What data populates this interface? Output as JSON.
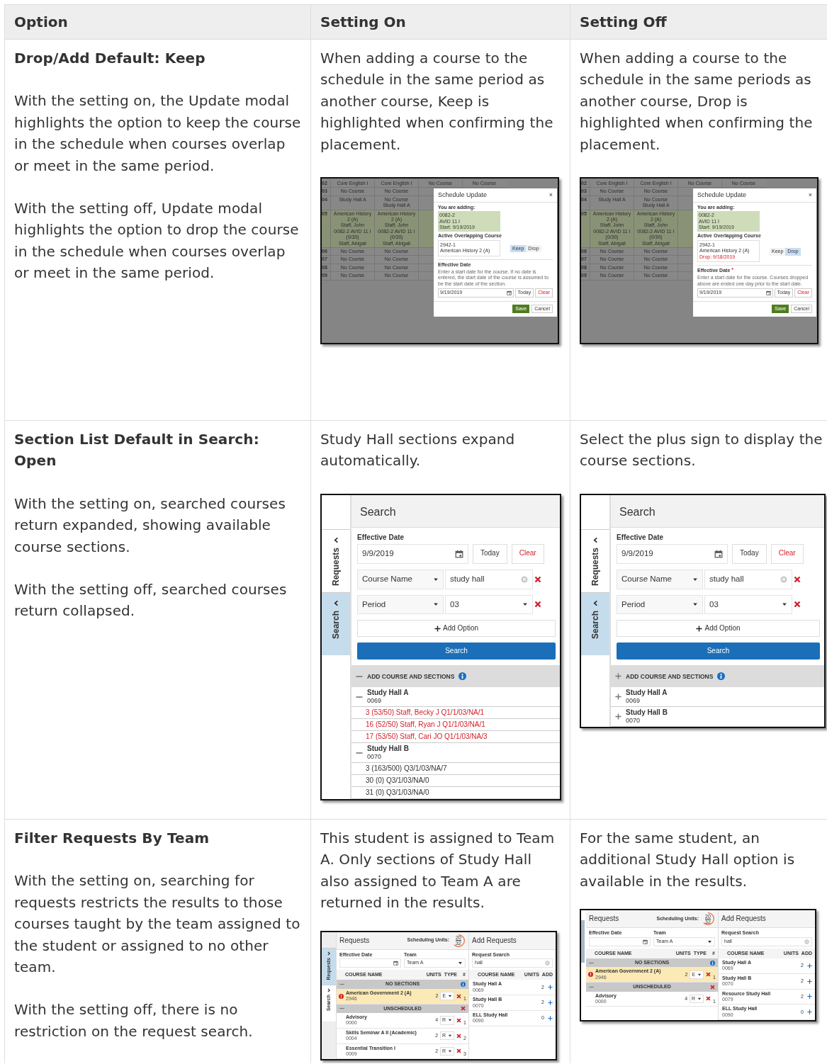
{
  "columns": [
    "Option",
    "Setting On",
    "Setting Off"
  ],
  "rows": [
    {
      "option": {
        "title": "Drop/Add Default: Keep",
        "paragraphs": [
          "With the setting on, the Update modal highlights the option to keep the course in the schedule when courses overlap or meet in the same period.",
          "With the setting off, Update modal highlights the option to drop the course in the schedule when courses overlap or meet in the same period."
        ]
      },
      "on": {
        "text": "When adding a course to the schedule in the same period as another course, Keep is highlighted when confirming the placement.",
        "screenshot": {
          "kind": "schedule_update",
          "grid": [
            {
              "period": "02",
              "highlighted": false,
              "cells": [
                "Core English I",
                "Core English I",
                "No Course",
                "No Course"
              ]
            },
            {
              "period": "03",
              "highlighted": false,
              "cells": [
                "No Course",
                "No Course"
              ]
            },
            {
              "period": "04",
              "highlighted": false,
              "cells": [
                "Study Hall A",
                "No Course\nStudy Hall A"
              ]
            },
            {
              "period": "05",
              "highlighted": true,
              "cells": [
                "American History 2 (A)\nStaff, John\n0082-2 AVID 11 I (0/30)\nStaff, Abigail",
                "American History 2 (A)\nStaff, John\n0082-2 AVID 11 I (0/30)\nStaff, Abigail"
              ]
            },
            {
              "period": "06",
              "highlighted": false,
              "cells": [
                "No Course",
                "No Course"
              ]
            },
            {
              "period": "07",
              "highlighted": false,
              "cells": [
                "No Course",
                "No Course"
              ]
            },
            {
              "period": "08",
              "highlighted": false,
              "cells": [
                "No Course",
                "No Course"
              ]
            },
            {
              "period": "09",
              "highlighted": false,
              "cells": [
                "No Course",
                "No Course"
              ]
            }
          ],
          "modal": {
            "title": "Schedule Update",
            "close": "×",
            "adding_label": "You are adding:",
            "adding": "0082-2\nAVID 11 I\nStart: 9/19/2019",
            "overlap_label": "Active Overlapping Course",
            "overlap": "2942-1\nAmerican History 2 (A)",
            "toggle": [
              {
                "label": "Keep",
                "selected": true
              },
              {
                "label": "Drop",
                "selected": false
              }
            ],
            "date_label": "Effective Date",
            "help": "Enter a start date for the course. If no date is entered, the start date of the course is assumed to be the start date of the section.",
            "date": "9/19/2019",
            "today": "Today",
            "clear": "Clear",
            "save": "Save",
            "cancel": "Cancel"
          }
        }
      },
      "off": {
        "text": "When adding a course to the schedule in the same periods as another course, Drop is highlighted when confirming the placement.",
        "screenshot": {
          "kind": "schedule_update",
          "grid": [
            {
              "period": "02",
              "highlighted": false,
              "cells": [
                "Core English I",
                "Core English I",
                "No Course",
                "No Course"
              ]
            },
            {
              "period": "03",
              "highlighted": false,
              "cells": [
                "No Course",
                "No Course"
              ]
            },
            {
              "period": "04",
              "highlighted": false,
              "cells": [
                "Study Hall A",
                "No Course\nStudy Hall A"
              ]
            },
            {
              "period": "05",
              "highlighted": true,
              "cells": [
                "American History 2 (A)\nStaff, John\n0082-2 AVID 11 I (0/30)\nStaff, Abigail",
                "American History 2 (A)\nStaff, John\n0082-2 AVID 11 I (0/30)\nStaff, Abigail"
              ]
            },
            {
              "period": "06",
              "highlighted": false,
              "cells": [
                "No Course",
                "No Course"
              ]
            },
            {
              "period": "07",
              "highlighted": false,
              "cells": [
                "No Course",
                "No Course"
              ]
            },
            {
              "period": "08",
              "highlighted": false,
              "cells": [
                "No Course",
                "No Course"
              ]
            },
            {
              "period": "09",
              "highlighted": false,
              "cells": [
                "No Course",
                "No Course"
              ]
            }
          ],
          "modal": {
            "title": "Schedule Update",
            "close": "×",
            "adding_label": "You are adding:",
            "adding": "0082-2\nAVID 11 I\nStart: 9/19/2019",
            "overlap_label": "Active Overlapping Course",
            "overlap": "2942-1\nAmerican History 2 (A)",
            "drop_note": "Drop: 9/18/2019",
            "toggle": [
              {
                "label": "Keep",
                "selected": false
              },
              {
                "label": "Drop",
                "selected": true
              }
            ],
            "date_label": "Effective Date",
            "required_mark": "*",
            "help": "Enter a start date for the course. Courses dropped above are ended one day prior to the start date.",
            "date": "9/19/2019",
            "today": "Today",
            "clear": "Clear",
            "save": "Save",
            "cancel": "Cancel"
          }
        }
      }
    },
    {
      "option": {
        "title": "Section List Default in Search: Open",
        "paragraphs": [
          "With the setting on, searched courses return expanded, showing available course sections.",
          "With the setting off, searched courses return collapsed."
        ]
      },
      "on": {
        "text": "Study Hall sections expand automatically.",
        "screenshot": {
          "kind": "search_panel",
          "title": "Search",
          "side_tabs": [
            {
              "label": "Requests",
              "selected": false
            },
            {
              "label": "Search",
              "selected": true
            }
          ],
          "date_label": "Effective Date",
          "date": "9/9/2019",
          "today": "Today",
          "clear": "Clear",
          "filters": [
            {
              "field": "Course Name",
              "value": "study hall",
              "kind": "text"
            },
            {
              "field": "Period",
              "value": "03",
              "kind": "select"
            }
          ],
          "add_option": "Add Option",
          "search_button": "Search",
          "results_header": "ADD COURSE AND SECTIONS",
          "expanded": true,
          "courses": [
            {
              "name": "Study Hall A",
              "code": "0069",
              "expanded": true,
              "sections": [
                {
                  "text": "3 (53/50) Staff, Becky J  Q1/1/03/NA/1",
                  "full": true
                },
                {
                  "text": "16 (52/50) Staff, Ryan J  Q1/1/03/NA/1",
                  "full": true
                },
                {
                  "text": "17 (53/50) Staff, Cari JO  Q1/1/03/NA/3",
                  "full": true
                }
              ]
            },
            {
              "name": "Study Hall B",
              "code": "0070",
              "expanded": true,
              "sections": [
                {
                  "text": "3 (163/500)  Q3/1/03/NA/7",
                  "full": false
                },
                {
                  "text": "30 (0)  Q3/1/03/NA/0",
                  "full": false
                },
                {
                  "text": "31 (0)  Q3/1/03/NA/0",
                  "full": false
                }
              ]
            }
          ]
        }
      },
      "off": {
        "text": "Select the plus sign to display the course sections.",
        "screenshot": {
          "kind": "search_panel",
          "title": "Search",
          "side_tabs": [
            {
              "label": "Requests",
              "selected": false
            },
            {
              "label": "Search",
              "selected": true
            }
          ],
          "date_label": "Effective Date",
          "date": "9/9/2019",
          "today": "Today",
          "clear": "Clear",
          "filters": [
            {
              "field": "Course Name",
              "value": "study hall",
              "kind": "text"
            },
            {
              "field": "Period",
              "value": "03",
              "kind": "select"
            }
          ],
          "add_option": "Add Option",
          "search_button": "Search",
          "results_header": "ADD COURSE AND SECTIONS",
          "expanded": false,
          "courses": [
            {
              "name": "Study Hall A",
              "code": "0069",
              "expanded": false
            },
            {
              "name": "Study Hall B",
              "code": "0070",
              "expanded": false
            }
          ]
        }
      }
    },
    {
      "option": {
        "title": "Filter Requests By Team",
        "paragraphs": [
          "With the setting on, searching for requests restricts the results to those courses taught by the team assigned to the student or assigned to no other team.",
          "With the setting off, there is no restriction on the request search."
        ]
      },
      "on": {
        "text": "This student is assigned to Team A. Only sections of Study Hall also assigned to Team A are returned in the results.",
        "screenshot": {
          "kind": "requests",
          "side_tabs": [
            {
              "label": "Requests",
              "selected": true
            },
            {
              "label": "Search",
              "selected": false
            }
          ],
          "title": "Requests",
          "units_label": "Scheduling Units:",
          "units_earned": "20",
          "units_total": "32",
          "date_label": "Effective Date",
          "team_label": "Team",
          "team": "Team A",
          "columns": [
            "COURSE NAME",
            "UNITS",
            "TYPE",
            "#"
          ],
          "groups": [
            {
              "label": "NO SECTIONS",
              "kind": "info",
              "rows": [
                {
                  "name": "American Government 2 (A)",
                  "code": "2946",
                  "units": "2",
                  "type": "E",
                  "num": "1",
                  "warning": true
                }
              ]
            },
            {
              "label": "UNSCHEDULED",
              "kind": "removable",
              "rows": [
                {
                  "name": "Advisory",
                  "code": "0000",
                  "units": "4",
                  "type": "R",
                  "num": "1",
                  "warning": false
                },
                {
                  "name": "Skills Seminar A II (Academic)",
                  "code": "0004",
                  "units": "2",
                  "type": "R",
                  "num": "2",
                  "warning": false
                },
                {
                  "name": "Essential Transition I",
                  "code": "0009",
                  "units": "2",
                  "type": "R",
                  "num": "3",
                  "warning": false
                }
              ]
            }
          ],
          "add_title": "Add Requests",
          "search_label": "Request Search",
          "search_value": "hall",
          "add_columns": [
            "COURSE NAME",
            "UNITS",
            "ADD"
          ],
          "results": [
            {
              "name": "Study Hall A",
              "code": "0069",
              "units": "2"
            },
            {
              "name": "Study Hall B",
              "code": "0070",
              "units": "2"
            },
            {
              "name": "ELL Study Hall",
              "code": "0090",
              "units": "0"
            }
          ]
        }
      },
      "off": {
        "text": "For the same student, an additional Study Hall option is available in the results.",
        "screenshot": {
          "kind": "requests",
          "title": "Requests",
          "units_label": "Scheduling Units:",
          "units_earned": "20",
          "units_total": "32",
          "date_label": "Effective Date",
          "team_label": "Team",
          "team": "Team A",
          "columns": [
            "COURSE NAME",
            "UNITS",
            "TYPE",
            "#"
          ],
          "groups": [
            {
              "label": "NO SECTIONS",
              "kind": "info",
              "rows": [
                {
                  "name": "American Government 2 (A)",
                  "code": "2946",
                  "units": "2",
                  "type": "E",
                  "num": "1",
                  "warning": true
                }
              ]
            },
            {
              "label": "UNSCHEDULED",
              "kind": "removable",
              "rows": [
                {
                  "name": "Advisory",
                  "code": "0000",
                  "units": "4",
                  "type": "R",
                  "num": "1",
                  "warning": false
                }
              ]
            }
          ],
          "add_title": "Add Requests",
          "search_label": "Request Search",
          "search_value": "hall",
          "add_columns": [
            "COURSE NAME",
            "UNITS",
            "ADD"
          ],
          "results": [
            {
              "name": "Study Hall A",
              "code": "0069",
              "units": "2"
            },
            {
              "name": "Study Hall B",
              "code": "0070",
              "units": "2"
            },
            {
              "name": "Resource Study Hall",
              "code": "0079",
              "units": "2"
            },
            {
              "name": "ELL Study Hall",
              "code": "0090",
              "units": "0"
            }
          ]
        }
      }
    }
  ]
}
